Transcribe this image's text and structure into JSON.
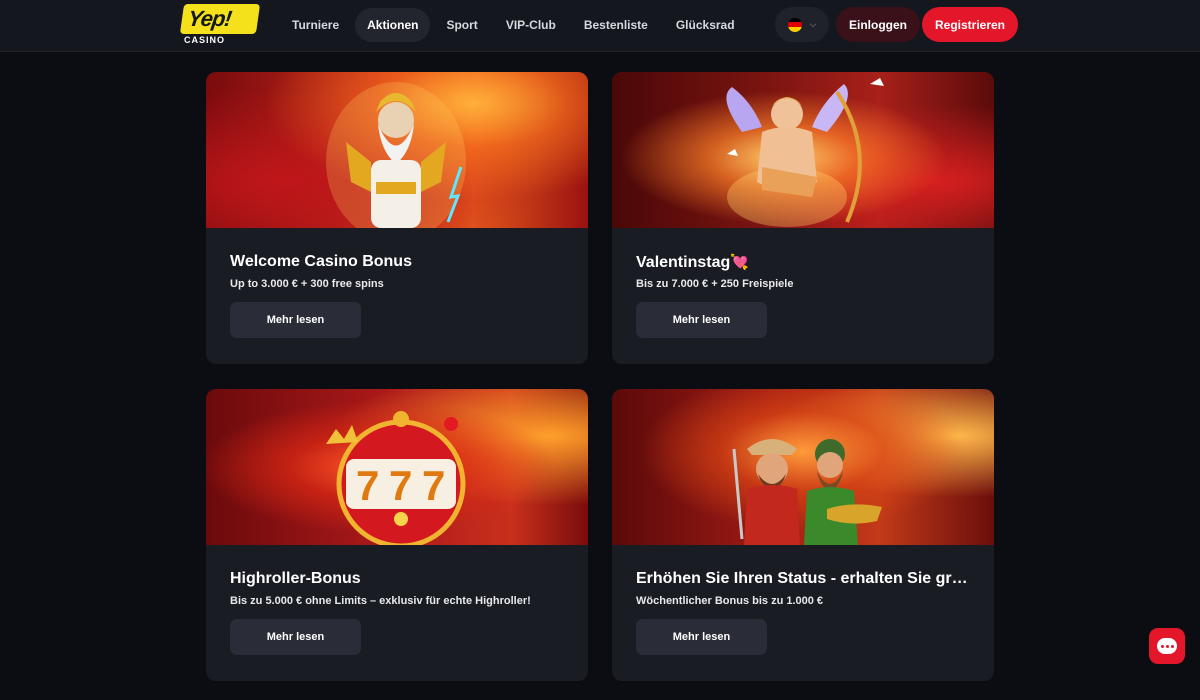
{
  "brand": {
    "logo_text": "Yep!",
    "logo_sub": "CASINO",
    "accent_yellow": "#f5e11b",
    "accent_red": "#e3162a"
  },
  "nav": {
    "items": [
      {
        "label": "Turniere",
        "active": false
      },
      {
        "label": "Aktionen",
        "active": true
      },
      {
        "label": "Sport",
        "active": false
      },
      {
        "label": "VIP-Club",
        "active": false
      },
      {
        "label": "Bestenliste",
        "active": false
      },
      {
        "label": "Glücksrad",
        "active": false
      }
    ]
  },
  "header": {
    "language_flag": "germany-flag-icon",
    "login_label": "Einloggen",
    "register_label": "Registrieren"
  },
  "promotions": [
    {
      "title": "Welcome Casino Bonus",
      "subtitle": "Up to 3.000 € + 300 free spins",
      "button": "Mehr lesen",
      "image": "zeus-god-illustration"
    },
    {
      "title": "Valentinstag",
      "title_emoji": "💘",
      "subtitle": "Bis zu 7.000 € + 250 Freispiele",
      "button": "Mehr lesen",
      "image": "cupid-illustration"
    },
    {
      "title": "Highroller-Bonus",
      "subtitle": "Bis zu 5.000 € ohne Limits – exklusiv für echte Highroller!",
      "button": "Mehr lesen",
      "image": "777-slot-machine-illustration"
    },
    {
      "title": "Erhöhen Sie Ihren Status - erhalten Sie größ...",
      "subtitle": "Wöchentlicher Bonus bis zu 1.000 €",
      "button": "Mehr lesen",
      "image": "two-adventurers-illustration"
    }
  ],
  "chat": {
    "icon": "chat-bubble-icon"
  }
}
